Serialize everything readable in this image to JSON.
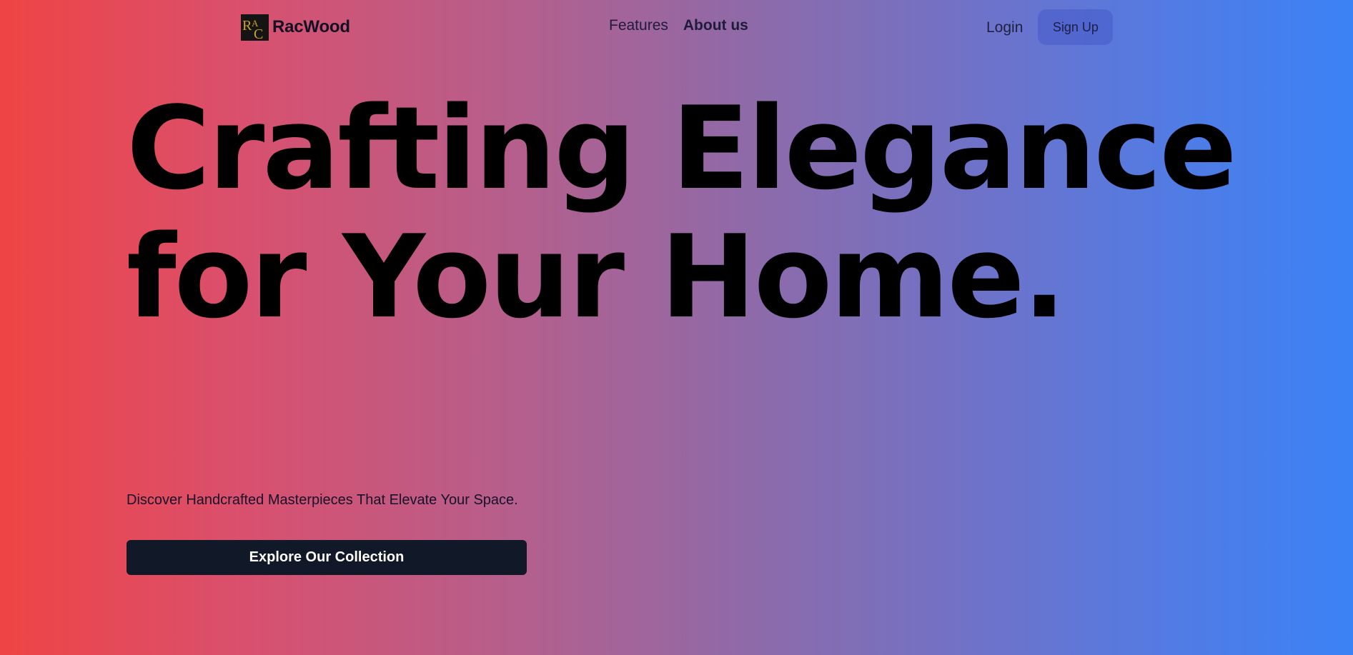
{
  "brand": {
    "name": "RacWood",
    "logo_letters": "RAC",
    "logo_color": "#c9a227"
  },
  "nav": {
    "links": [
      {
        "label": "Features",
        "active": false
      },
      {
        "label": "About us",
        "active": true
      }
    ]
  },
  "auth": {
    "login_label": "Login",
    "signup_label": "Sign Up"
  },
  "hero": {
    "title_line1": "Crafting Elegance",
    "title_line2": "for Your Home.",
    "tagline": "Discover Handcrafted Masterpieces That Elevate Your Space.",
    "cta_label": "Explore Our Collection"
  },
  "colors": {
    "gradient_start": "#ef4444",
    "gradient_end": "#3b82f6",
    "cta_background": "#111827"
  }
}
